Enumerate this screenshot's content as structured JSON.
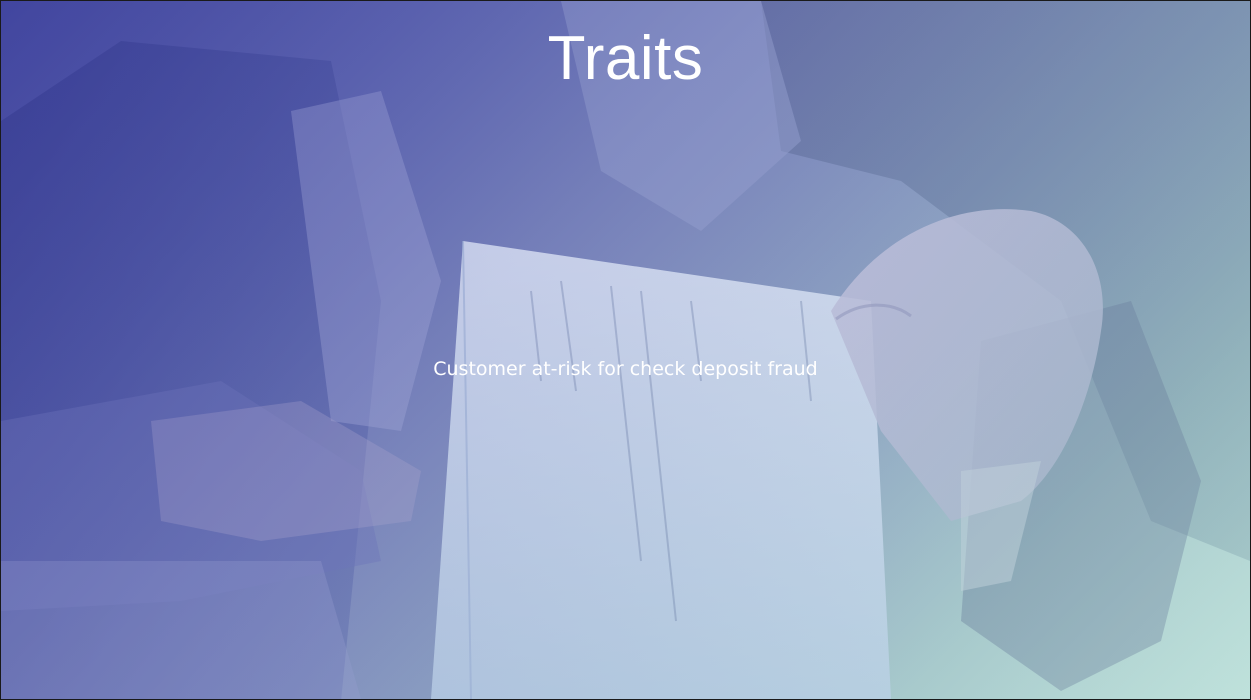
{
  "slide": {
    "title": "Traits",
    "body": "Customer at-risk for check deposit fraud"
  },
  "background": {
    "image_subject": "hand-holding-check-photo",
    "tint_start": "#3f4599",
    "tint_end": "#bfe0db"
  }
}
